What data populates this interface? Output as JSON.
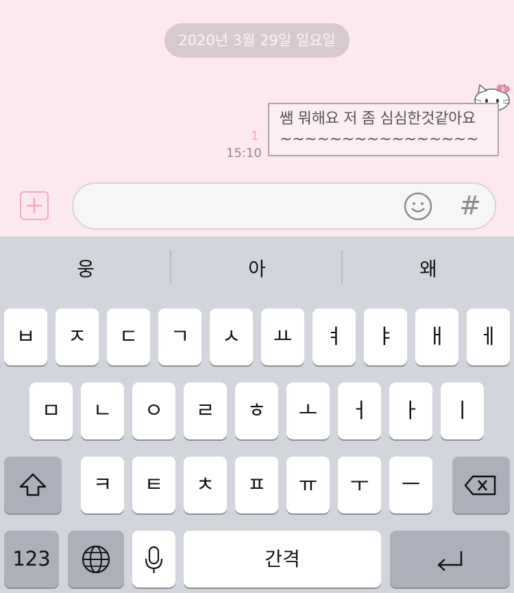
{
  "chat": {
    "date": "2020년 3월 29일 일요일",
    "message": {
      "line1": "쌤 뭐해요 저 좀 심심한것같아요",
      "line2": "~~~~~~~~~~~~~~~~",
      "read_count": "1",
      "time": "15:10"
    }
  },
  "suggestions": [
    "웅",
    "아",
    "왜"
  ],
  "keyboard": {
    "row1": [
      "ㅂ",
      "ㅈ",
      "ㄷ",
      "ㄱ",
      "ㅅ",
      "ㅛ",
      "ㅕ",
      "ㅑ",
      "ㅐ",
      "ㅔ"
    ],
    "row2": [
      "ㅁ",
      "ㄴ",
      "ㅇ",
      "ㄹ",
      "ㅎ",
      "ㅗ",
      "ㅓ",
      "ㅏ",
      "ㅣ"
    ],
    "row3": [
      "ㅋ",
      "ㅌ",
      "ㅊ",
      "ㅍ",
      "ㅠ",
      "ㅜ",
      "ㅡ"
    ],
    "numbers_label": "123",
    "space_label": "간격"
  },
  "icons": {
    "plus": "plus-icon",
    "emoji": "smiley-icon",
    "hash": "#",
    "shift": "shift-icon",
    "backspace": "backspace-icon",
    "globe": "globe-icon",
    "mic": "microphone-icon",
    "return": "return-icon",
    "sticker": "hello-kitty-icon"
  },
  "colors": {
    "chat_bg": "#fde8ef",
    "accent_pink": "#f2a9c4",
    "keyboard_bg": "#d3d5dc"
  }
}
